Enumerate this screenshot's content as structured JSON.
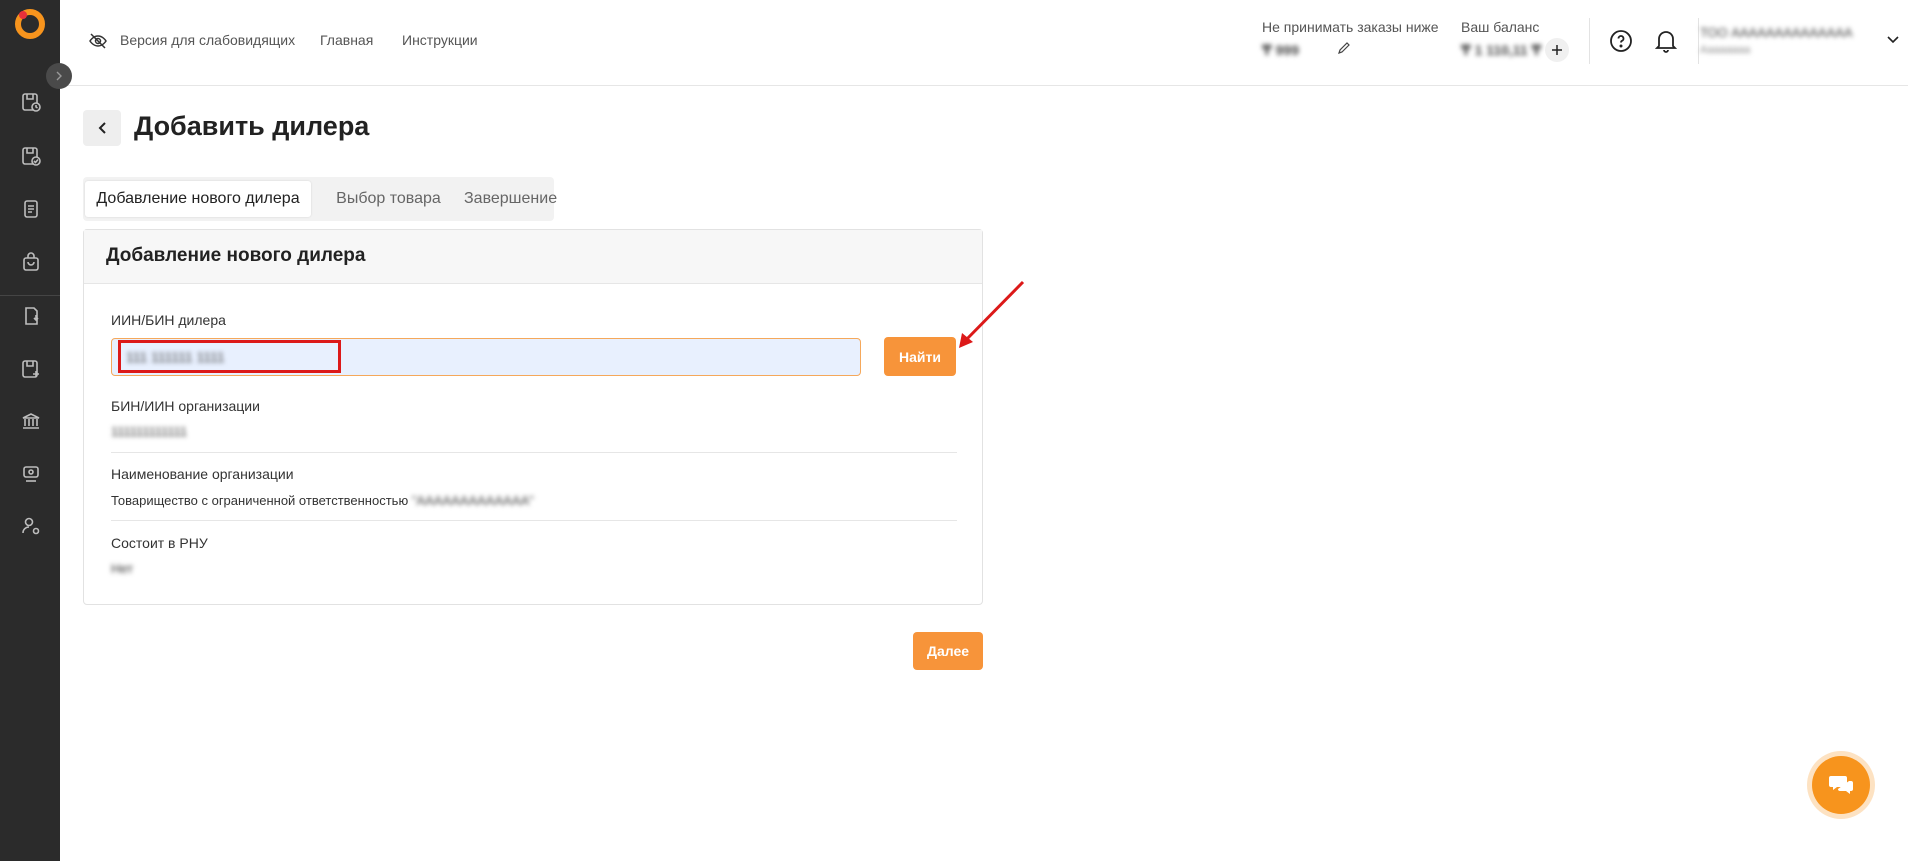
{
  "colors": {
    "accent": "#f7943a",
    "sidebar_bg": "#2b2b2b",
    "annotation": "#dc1919",
    "input_bg": "#e8f0fe"
  },
  "topbar": {
    "accessibility_label": "Версия для слабовидящих",
    "home_label": "Главная",
    "instructions_label": "Инструкции",
    "min_order_label": "Не принимать заказы ниже",
    "min_order_value": "₸ 999",
    "balance_label": "Ваш баланс",
    "balance_value": "₸ 1 110,11 ₸",
    "user_name": "ТОО АААААААААААААА",
    "user_sub": "Аааааааа"
  },
  "sidebar": {
    "icons": [
      "orders-clock-icon",
      "orders-check-icon",
      "document-icon",
      "bag-icon",
      "return-icon",
      "add-product-icon",
      "bank-icon",
      "support-icon",
      "user-settings-icon"
    ]
  },
  "page": {
    "title": "Добавить дилера"
  },
  "tabs": [
    {
      "label": "Добавление нового дилера",
      "active": true
    },
    {
      "label": "Выбор товара",
      "active": false
    },
    {
      "label": "Завершение",
      "active": false
    }
  ],
  "card": {
    "title": "Добавление нового дилера",
    "iin_label": "ИИН/БИН дилера",
    "iin_value": "111 111111 1111",
    "find_button": "Найти",
    "bin_label": "БИН/ИИН организации",
    "bin_value": "111111111111",
    "org_name_label": "Наименование организации",
    "org_name_prefix": "Товарищество с ограниченной ответственностью",
    "org_name_suffix": "\"ААААААААААААА\"",
    "rnu_label": "Состоит в РНУ",
    "rnu_value": "Нет"
  },
  "next_button": "Далее"
}
